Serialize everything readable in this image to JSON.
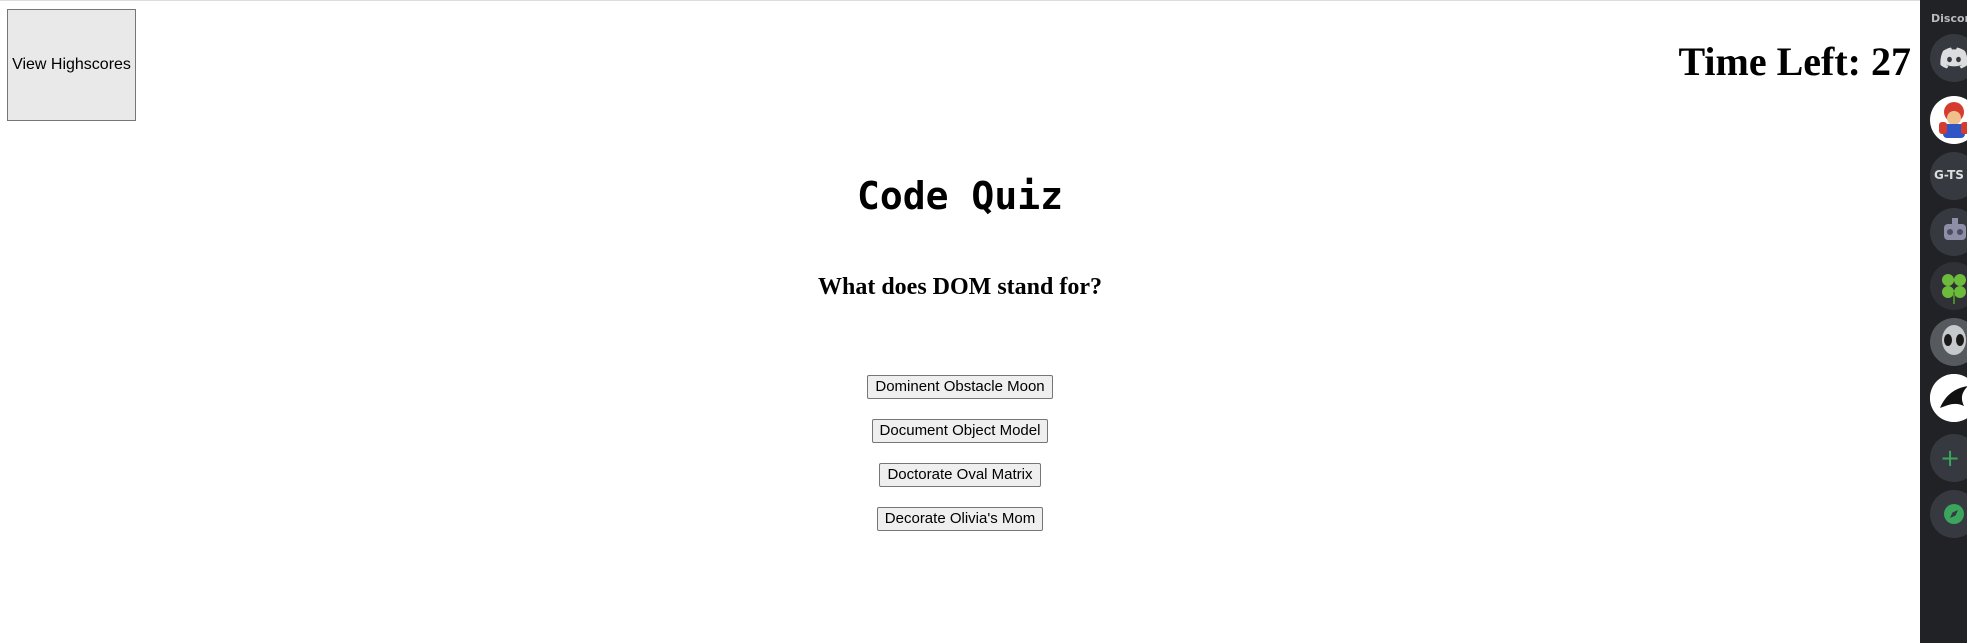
{
  "header": {
    "highscores_label": "View Highscores",
    "timer_label": "Time Left:",
    "timer_value": "27"
  },
  "quiz": {
    "title": "Code Quiz",
    "question": "What does DOM stand for?",
    "answers": [
      "Dominent Obstacle Moon",
      "Document Object Model",
      "Doctorate Oval Matrix",
      "Decorate Olivia's Mom"
    ]
  },
  "discord": {
    "label": "Discord",
    "server_text": "G-TS"
  },
  "colors": {
    "page_bg": "#ffffff",
    "button_bg": "#efefef",
    "discord_rail": "#202225",
    "discord_green": "#3ba55d"
  }
}
